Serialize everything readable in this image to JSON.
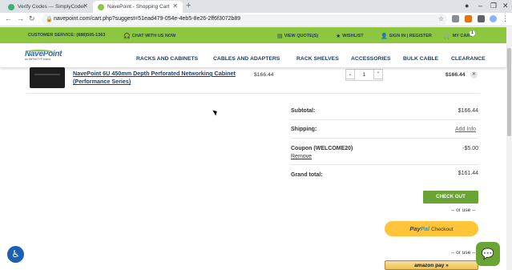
{
  "browser": {
    "tabs": [
      {
        "title": "Verify Codes — SimplyCodes",
        "favicon_color": "#3bb273"
      },
      {
        "title": "NavePoint - Shopping Cart",
        "favicon_color": "#8dc63f"
      }
    ],
    "url": "navepoint.com/cart.php?suggest=51ead479-054e-4eb5-8e26-2ff6f3072b89"
  },
  "topbar": {
    "customer_service": "CUSTOMER SERVICE: (888)505-1363",
    "chat": "CHAT WITH US NOW",
    "view_quotes": "VIEW QUOTE(S)",
    "wishlist": "WISHLIST",
    "signin": "SIGN IN | REGISTER",
    "mycart": "MY CART",
    "cart_count": "1"
  },
  "logo": {
    "name": "NavePoint",
    "tagline": "an INFINITY® brand"
  },
  "nav": {
    "items": [
      "RACKS AND CABINETS",
      "CABLES AND ADAPTERS",
      "RACK SHELVES",
      "ACCESSORIES",
      "BULK CABLE",
      "CLEARANCE"
    ]
  },
  "cart": {
    "item": {
      "name": "NavePoint 6U 450mm Depth Perforated Networking Cabinet (Performance Series)",
      "price": "$166.44",
      "qty": "1",
      "total": "$166.44"
    }
  },
  "summary": {
    "subtotal_label": "Subtotal:",
    "subtotal_value": "$166.44",
    "shipping_label": "Shipping:",
    "shipping_link": "Add Info",
    "coupon_label": "Coupon (WELCOME20)",
    "coupon_remove": "Remove",
    "coupon_value": "-$5.00",
    "grand_label": "Grand total:",
    "grand_value": "$161.44",
    "checkout": "CHECK OUT",
    "or_use_1": "-- or use --",
    "or_use_2": "-- or use --",
    "paypal_pay": "Pay",
    "paypal_pal": "Pal",
    "paypal_checkout": "Checkout",
    "amazon": "amazon pay"
  },
  "colors": {
    "brand_green": "#8dc63f",
    "navy": "#1d3a5f",
    "checkout_green": "#6aa434",
    "paypal_yellow": "#ffc439"
  }
}
